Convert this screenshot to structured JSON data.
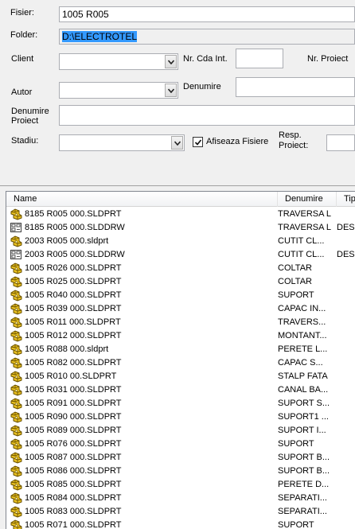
{
  "form": {
    "fisier_label": "Fisier:",
    "fisier_value": "1005 R005",
    "folder_label": "Folder:",
    "folder_value": "D:\\ELECTROTEL",
    "client_label": "Client",
    "client_value": "",
    "nr_cda_int_label": "Nr. Cda Int.",
    "nr_cda_int_value": "",
    "nr_proiect_label": "Nr. Proiect",
    "autor_label": "Autor",
    "autor_value": "",
    "denumire_label": "Denumire",
    "denumire_value": "",
    "denumire_proiect_label_1": "Denumire",
    "denumire_proiect_label_2": "Proiect",
    "denumire_proiect_value": "",
    "stadiu_label": "Stadiu:",
    "stadiu_value": "",
    "afiseaza_fisiere_label": "Afiseaza Fisiere",
    "afiseaza_fisiere_checked": true,
    "resp_proiect_label_1": "Resp.",
    "resp_proiect_label_2": "Proiect:",
    "resp_proiect_value": ""
  },
  "file_list": {
    "columns": [
      "Name",
      "Denumire",
      "TipD"
    ],
    "rows": [
      {
        "icon": "part-icon",
        "name": "8185 R005 000.SLDPRT",
        "denumire": "TRAVERSA L",
        "tip": ""
      },
      {
        "icon": "drawing-icon",
        "name": "8185 R005 000.SLDDRW",
        "denumire": "TRAVERSA L",
        "tip": "DESE"
      },
      {
        "icon": "part-icon",
        "name": "2003 R005 000.sldprt",
        "denumire": "CUTIT CL...",
        "tip": ""
      },
      {
        "icon": "drawing-icon",
        "name": "2003 R005 000.SLDDRW",
        "denumire": "CUTIT CL...",
        "tip": "DESE"
      },
      {
        "icon": "part-icon",
        "name": "1005 R026 000.SLDPRT",
        "denumire": "COLTAR",
        "tip": ""
      },
      {
        "icon": "part-icon",
        "name": "1005 R025 000.SLDPRT",
        "denumire": "COLTAR",
        "tip": ""
      },
      {
        "icon": "part-icon",
        "name": "1005 R040 000.SLDPRT",
        "denumire": "SUPORT",
        "tip": ""
      },
      {
        "icon": "part-icon",
        "name": "1005 R039 000.SLDPRT",
        "denumire": "CAPAC IN...",
        "tip": ""
      },
      {
        "icon": "part-icon",
        "name": "1005 R011 000.SLDPRT",
        "denumire": "TRAVERS...",
        "tip": ""
      },
      {
        "icon": "part-icon",
        "name": "1005 R012 000.SLDPRT",
        "denumire": "MONTANT...",
        "tip": ""
      },
      {
        "icon": "part-icon",
        "name": "1005 R088 000.sldprt",
        "denumire": "PERETE L...",
        "tip": ""
      },
      {
        "icon": "part-icon",
        "name": "1005 R082 000.SLDPRT",
        "denumire": "CAPAC S...",
        "tip": ""
      },
      {
        "icon": "part-icon",
        "name": "1005 R010 00.SLDPRT",
        "denumire": "STALP FATA",
        "tip": ""
      },
      {
        "icon": "part-icon",
        "name": "1005 R031 000.SLDPRT",
        "denumire": "CANAL BA...",
        "tip": ""
      },
      {
        "icon": "part-icon",
        "name": "1005 R091 000.SLDPRT",
        "denumire": "SUPORT S...",
        "tip": ""
      },
      {
        "icon": "part-icon",
        "name": "1005 R090 000.SLDPRT",
        "denumire": "SUPORT1 ...",
        "tip": ""
      },
      {
        "icon": "part-icon",
        "name": "1005 R089 000.SLDPRT",
        "denumire": "SUPORT I...",
        "tip": ""
      },
      {
        "icon": "part-icon",
        "name": "1005 R076 000.SLDPRT",
        "denumire": "SUPORT",
        "tip": ""
      },
      {
        "icon": "part-icon",
        "name": "1005 R087 000.SLDPRT",
        "denumire": "SUPORT B...",
        "tip": ""
      },
      {
        "icon": "part-icon",
        "name": "1005 R086 000.SLDPRT",
        "denumire": "SUPORT B...",
        "tip": ""
      },
      {
        "icon": "part-icon",
        "name": "1005 R085 000.SLDPRT",
        "denumire": "PERETE D...",
        "tip": ""
      },
      {
        "icon": "part-icon",
        "name": "1005 R084 000.SLDPRT",
        "denumire": "SEPARATI...",
        "tip": ""
      },
      {
        "icon": "part-icon",
        "name": "1005 R083 000.SLDPRT",
        "denumire": "SEPARATI...",
        "tip": ""
      },
      {
        "icon": "part-icon",
        "name": "1005 R071 000.SLDPRT",
        "denumire": "SUPORT",
        "tip": ""
      }
    ]
  },
  "colors": {
    "selection_highlight": "#3399ff",
    "part_icon_yellow": "#e8c020",
    "drawing_icon_frame": "#404040"
  }
}
